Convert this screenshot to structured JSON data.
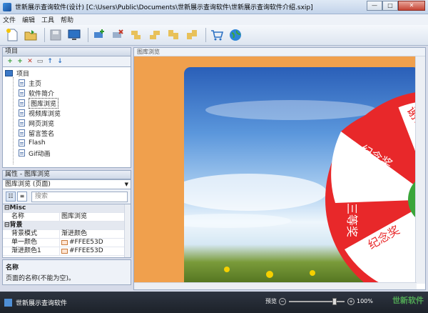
{
  "window": {
    "title": "世新展示查询软件(设计) [C:\\Users\\Public\\Documents\\世新展示查询软件\\世新展示查询软件介绍.sxip]"
  },
  "menu": [
    "文件",
    "编辑",
    "工具",
    "帮助"
  ],
  "tree": {
    "header": "项目",
    "root": "项目",
    "items": [
      "主页",
      "软件简介",
      "图库浏览",
      "视频库浏览",
      "网页浏览",
      "留言签名",
      "Flash",
      "Gif动画"
    ]
  },
  "props": {
    "header": "属性 - 图库浏览",
    "selected": "图库浏览  (页面)",
    "search_placeholder": "搜索",
    "misc_cat": "Misc",
    "bg_cat": "背景",
    "rows": [
      {
        "key": "名称",
        "value": "图库浏览"
      },
      {
        "key": "背景模式",
        "value": "渐进颜色"
      },
      {
        "key": "单一颜色",
        "value": "#FFEE53D"
      },
      {
        "key": "渐进颜色1",
        "value": "#FFEE53D"
      }
    ],
    "desc_title": "名称",
    "desc_text": "页面的名称(不能为空)。"
  },
  "canvas": {
    "tab": "图库浏览",
    "wheel_segments": [
      "谢谢",
      "纪念奖",
      "三等奖",
      "纪念奖"
    ]
  },
  "status": {
    "text": "世新展示查询软件",
    "zoom_label": "预览",
    "zoom_value": "100%",
    "zoom_level": 0.85
  },
  "watermark": "世新软件"
}
